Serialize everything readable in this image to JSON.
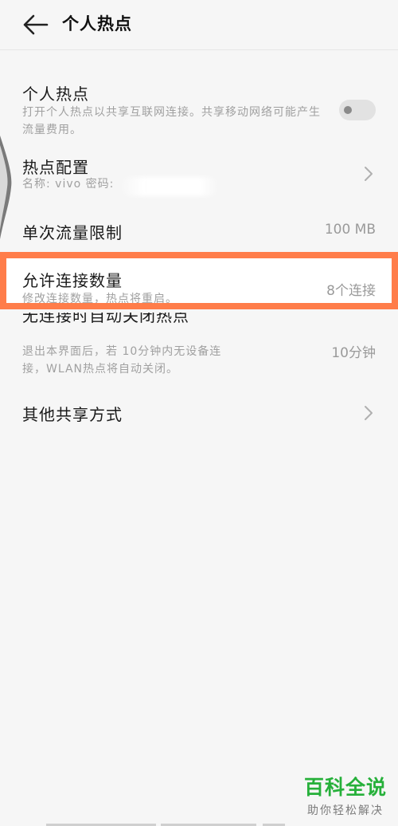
{
  "header": {
    "title": "个人热点"
  },
  "rows": {
    "hotspot": {
      "title": "个人热点",
      "desc": "打开个人热点以共享互联网连接。共享移动网络可能产生流量费用。"
    },
    "config": {
      "title": "热点配置",
      "desc": "名称: vivo  密码:"
    },
    "limit": {
      "title": "单次流量限制",
      "value": "100 MB"
    },
    "connections": {
      "title": "允许连接数量",
      "desc": "修改连接数量，热点将重启。",
      "value": "8个连接"
    },
    "auto_off": {
      "title": "无连接时自动关闭热点",
      "desc": "退出本界面后，若 10分钟内无设备连接，WLAN热点将自动关闭。",
      "value": "10分钟"
    },
    "other": {
      "title": "其他共享方式"
    }
  },
  "watermark": {
    "brand": "百科全说",
    "slogan": "助你轻松解决"
  },
  "colors": {
    "highlight": "#ff7d4a",
    "watermark": "#26b03a",
    "background": "#f6f6f6"
  }
}
